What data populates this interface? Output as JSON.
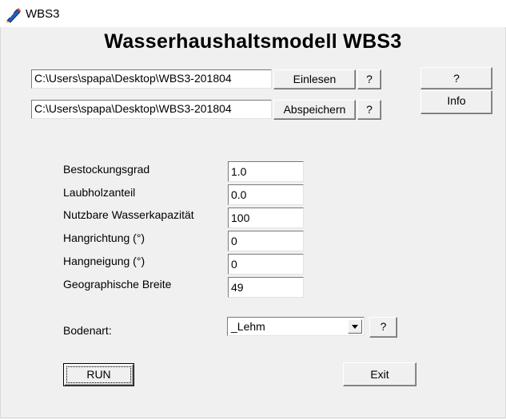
{
  "window": {
    "title": "WBS3",
    "icon": "pencil-app-icon"
  },
  "heading": "Wasserhaushaltsmodell WBS3",
  "files": {
    "input_path": "C:\\Users\\spapa\\Desktop\\WBS3-201804",
    "output_path": "C:\\Users\\spapa\\Desktop\\WBS3-201804",
    "read_label": "Einlesen",
    "save_label": "Abspeichern",
    "help_label": "?"
  },
  "side": {
    "help_label": "?",
    "info_label": "Info"
  },
  "params": [
    {
      "label": "Bestockungsgrad",
      "value": "1.0"
    },
    {
      "label": "Laubholzanteil",
      "value": "0.0"
    },
    {
      "label": "Nutzbare Wasserkapazität",
      "value": "100"
    },
    {
      "label": "Hangrichtung (°)",
      "value": "0"
    },
    {
      "label": "Hangneigung (°)",
      "value": "0"
    },
    {
      "label": "Geographische Breite",
      "value": "49"
    }
  ],
  "soil": {
    "label": "Bodenart:",
    "value": "_Lehm",
    "help_label": "?"
  },
  "actions": {
    "run_label": "RUN",
    "exit_label": "Exit"
  }
}
